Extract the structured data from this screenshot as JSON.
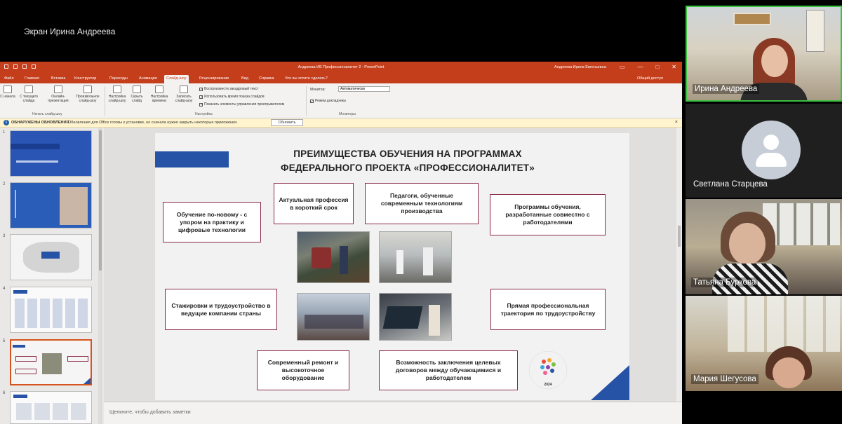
{
  "share_label": "Экран Ирина Андреева",
  "powerpoint": {
    "doc_title": "Андреева ИЕ Профессионалитет 2  -  PowerPoint",
    "user_name": "Андреева Ирина Евгеньевна",
    "tabs": [
      "Файл",
      "Главная",
      "Вставка",
      "Конструктор",
      "Переходы",
      "Анимация",
      "Слайд-шоу",
      "Рецензирование",
      "Вид",
      "Справка"
    ],
    "active_tab": "Слайд-шоу",
    "tell_me": "Что вы хотите сделать?",
    "share": "Общий доступ",
    "ribbon": {
      "from_start": "С начала",
      "from_current": "С текущего слайда",
      "online": "Онлайн-презентация",
      "custom": "Произвольное слайд-шоу",
      "group_start": "Начать слайд-шоу",
      "setup": "Настройка слайд-шоу",
      "hide": "Скрыть слайд",
      "rehearse": "Настройка времени",
      "record": "Записать слайд-шоу",
      "chk_narration": "Воспроизвести закадровый текст",
      "chk_timings": "Использовать время показа слайдов",
      "chk_controls": "Показать элементы управления проигрывателем",
      "group_setup": "Настройка",
      "monitor_label": "Монитор:",
      "monitor_value": "Автоматически",
      "presenter_view": "Режим докладчика",
      "group_monitors": "Мониторы"
    },
    "update_bar": {
      "title": "ОБНАРУЖЕНЫ ОБНОВЛЕНИЯ",
      "message": "Обновления для Office готовы к установке, но сначала нужно закрыть некоторые приложения.",
      "button": "Обновить"
    },
    "slide_numbers": [
      "1",
      "2",
      "3",
      "4",
      "5",
      "6"
    ],
    "selected_slide": 5,
    "notes_placeholder": "Щелкните, чтобы добавить заметки"
  },
  "slide": {
    "title_line1": "ПРЕИМУЩЕСТВА ОБУЧЕНИЯ НА ПРОГРАММАХ",
    "title_line2": "ФЕДЕРАЛЬНОГО ПРОЕКТА «ПРОФЕССИОНАЛИТЕТ»",
    "boxes": {
      "new_learning": "Обучение по-новому - с упором на практику и цифровые технологии",
      "actual_profession": "Актуальная профессия в короткий срок",
      "teachers": "Педагоги, обученные современным технологиям производства",
      "programs": "Программы обучения, разработанные совместно с работодателями",
      "internships": "Стажировки и трудоустройство в ведущие компании страны",
      "trajectory": "Прямая профессиональная траектория по трудоустройству",
      "equipment": "Современный ремонт и высокоточное оборудование",
      "contracts": "Возможность заключения целевых договоров между обучающимися и работодателем"
    },
    "logo_text": "ПРОФЕССИОНАЛИТЕТ",
    "logo_year": "2024"
  },
  "participants": [
    {
      "name": "Ирина Андреева"
    },
    {
      "name": "Светлана Старцева"
    },
    {
      "name": "Татьяна Буркова"
    },
    {
      "name": "Мария Шегусова"
    }
  ]
}
